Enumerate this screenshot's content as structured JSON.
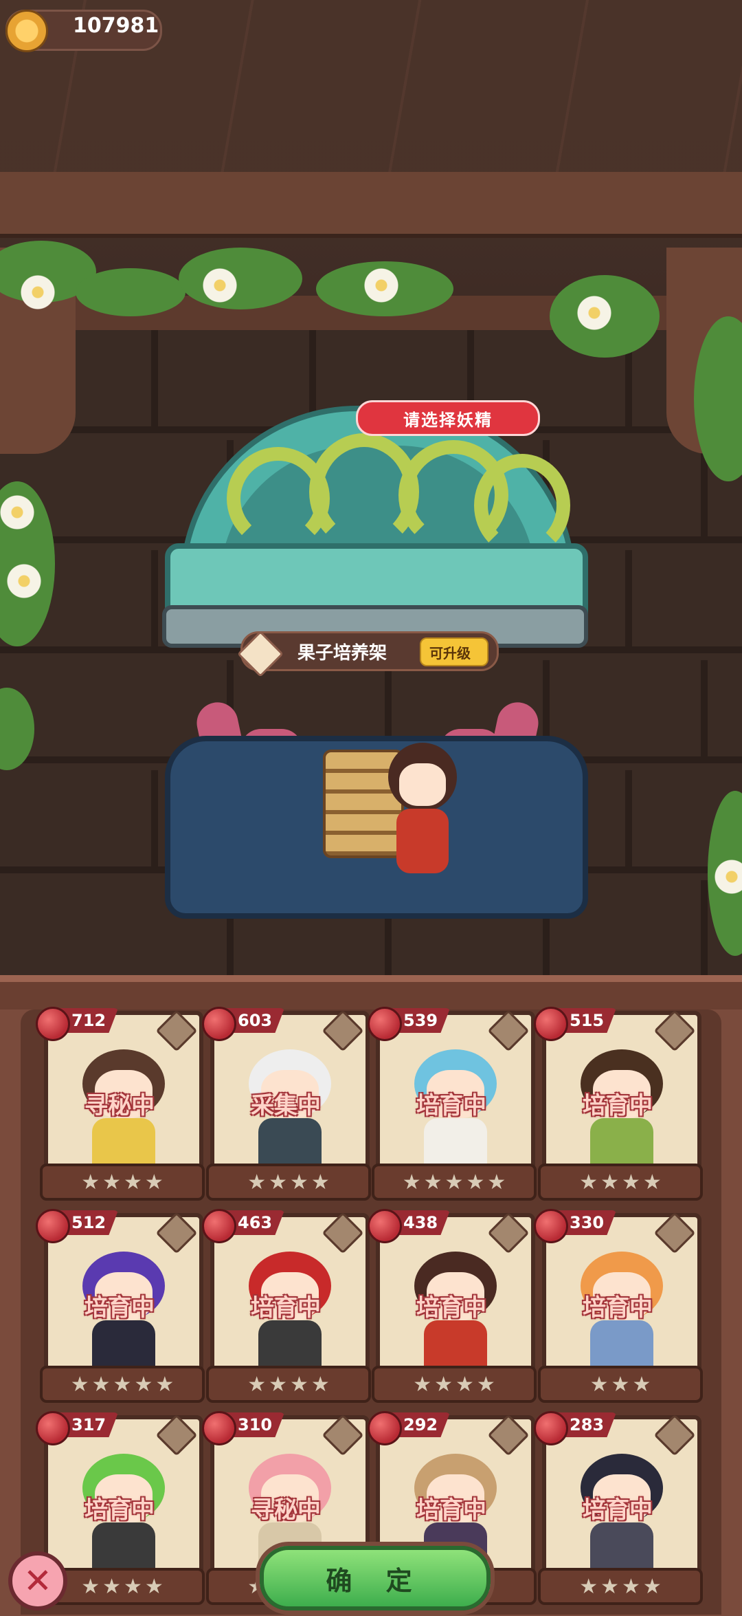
{
  "currency": {
    "value": "107981",
    "icon": "crown-coin-icon"
  },
  "shelf": {
    "hint": "请选择妖精",
    "name": "果子培养架",
    "upgrade_label": "可升级"
  },
  "sprites": [
    {
      "level": "712",
      "status": "寻秘中",
      "stars": 4,
      "hair": "#5a3a2c",
      "outfit": "#e9c64a"
    },
    {
      "level": "603",
      "status": "采集中",
      "stars": 4,
      "hair": "#eeeeee",
      "outfit": "#3a4a54"
    },
    {
      "level": "539",
      "status": "培育中",
      "stars": 5,
      "hair": "#6fc3e0",
      "outfit": "#f2efe8"
    },
    {
      "level": "515",
      "status": "培育中",
      "stars": 4,
      "hair": "#4a3020",
      "outfit": "#8ab04a"
    },
    {
      "level": "512",
      "status": "培育中",
      "stars": 5,
      "hair": "#5a3ab0",
      "outfit": "#2a2a3a"
    },
    {
      "level": "463",
      "status": "培育中",
      "stars": 4,
      "hair": "#c82a2a",
      "outfit": "#3a3a3a"
    },
    {
      "level": "438",
      "status": "培育中",
      "stars": 4,
      "hair": "#4a2a22",
      "outfit": "#c83a2a"
    },
    {
      "level": "330",
      "status": "培育中",
      "stars": 3,
      "hair": "#f09a4a",
      "outfit": "#7a9ac8"
    },
    {
      "level": "317",
      "status": "培育中",
      "stars": 4,
      "hair": "#6ac84a",
      "outfit": "#3a3a3a"
    },
    {
      "level": "310",
      "status": "寻秘中",
      "stars": 4,
      "hair": "#f2a0a8",
      "outfit": "#d8c8a8"
    },
    {
      "level": "292",
      "status": "培育中",
      "stars": 4,
      "hair": "#c8a070",
      "outfit": "#4a3a5a"
    },
    {
      "level": "283",
      "status": "培育中",
      "stars": 4,
      "hair": "#2a2a3a",
      "outfit": "#4a4a5a"
    }
  ],
  "buttons": {
    "confirm": "确 定",
    "close": "✕"
  }
}
